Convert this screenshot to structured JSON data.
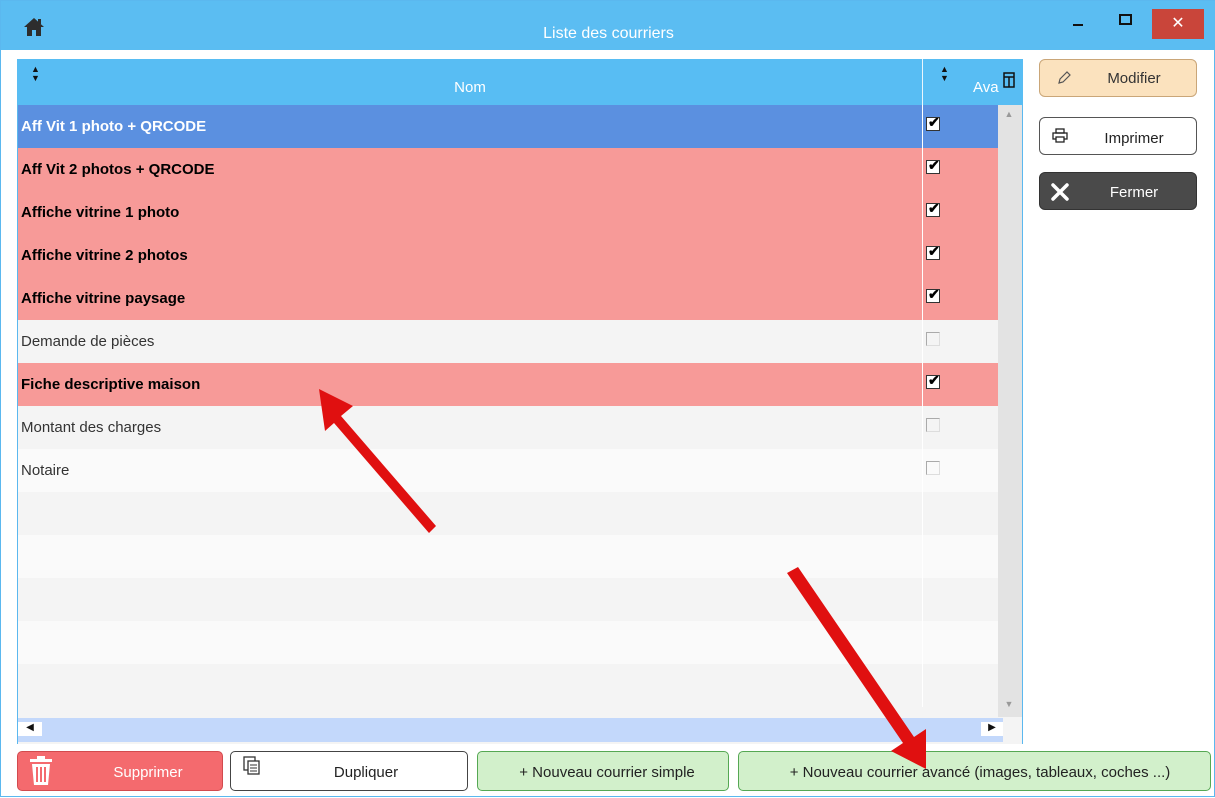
{
  "window": {
    "title": "Liste des courriers",
    "home_icon": "home-icon",
    "controls": {
      "minimize": "–",
      "maximize": "□",
      "close": "✕"
    }
  },
  "grid": {
    "columns": {
      "nom": "Nom",
      "avance": "Ava"
    },
    "rows": [
      {
        "name": "Aff Vit 1 photo + QRCODE",
        "checked": true,
        "style": "selected"
      },
      {
        "name": "Aff Vit 2 photos + QRCODE",
        "checked": true,
        "style": "pink"
      },
      {
        "name": "Affiche vitrine 1 photo",
        "checked": true,
        "style": "pink"
      },
      {
        "name": "Affiche vitrine 2 photos",
        "checked": true,
        "style": "pink"
      },
      {
        "name": "Affiche vitrine paysage",
        "checked": true,
        "style": "pink"
      },
      {
        "name": "Demande de pièces",
        "checked": false,
        "style": "plain"
      },
      {
        "name": "Fiche descriptive maison",
        "checked": true,
        "style": "pink"
      },
      {
        "name": "Montant des charges",
        "checked": false,
        "style": "plain"
      },
      {
        "name": "Notaire",
        "checked": false,
        "style": "plain2"
      },
      {
        "name": "",
        "checked": null,
        "style": "plain"
      },
      {
        "name": "",
        "checked": null,
        "style": "plain2"
      },
      {
        "name": "",
        "checked": null,
        "style": "plain"
      },
      {
        "name": "",
        "checked": null,
        "style": "plain2"
      },
      {
        "name": "",
        "checked": null,
        "style": "plain"
      }
    ]
  },
  "side_buttons": {
    "modifier": "Modifier",
    "imprimer": "Imprimer",
    "fermer": "Fermer"
  },
  "bottom_buttons": {
    "supprimer": "Supprimer",
    "dupliquer": "Dupliquer",
    "nouveau_simple": "+ Nouveau courrier simple",
    "nouveau_avance": "+ Nouveau courrier avancé (images, tableaux, coches ...)"
  },
  "colors": {
    "titlebar": "#5bbdf2",
    "selected_row": "#5b90e0",
    "pink_row": "#f79a98",
    "annotation_arrow": "#e01010"
  }
}
